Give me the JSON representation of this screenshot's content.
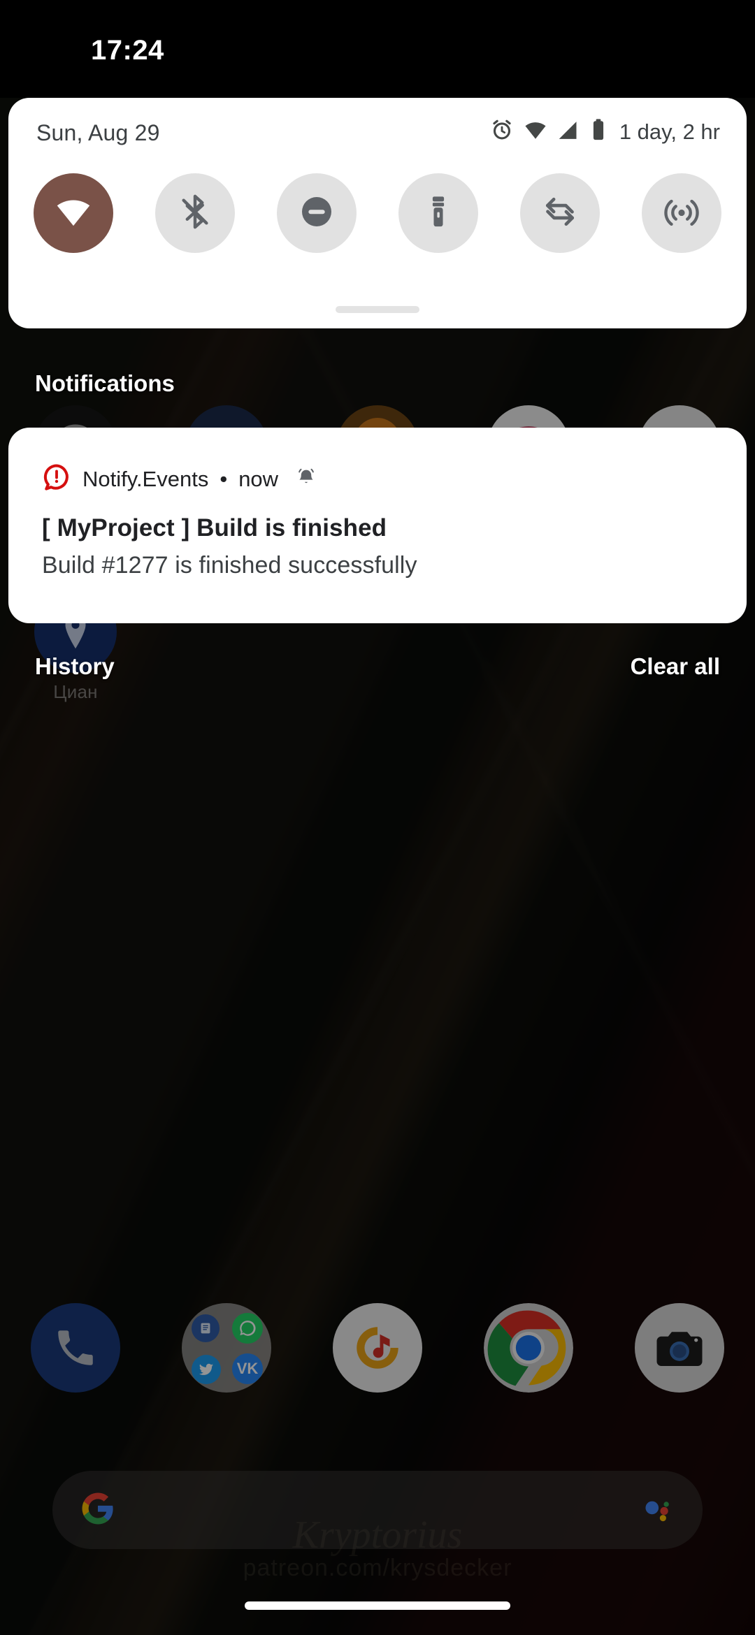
{
  "statusbar": {
    "clock": "17:24"
  },
  "quick_settings": {
    "date": "Sun, Aug 29",
    "battery_estimate": "1 day, 2 hr",
    "status_icons": [
      "alarm-icon",
      "wifi-icon",
      "cellular-signal-icon",
      "battery-icon"
    ],
    "active_tile_color": "#7a5248",
    "inactive_tile_color": "#e1e1e1",
    "tiles": [
      {
        "name": "wifi",
        "label": "Wi-Fi",
        "icon": "wifi-icon",
        "active": true
      },
      {
        "name": "bluetooth",
        "label": "Bluetooth",
        "icon": "bluetooth-off-icon",
        "active": false
      },
      {
        "name": "dnd",
        "label": "Do Not Disturb",
        "icon": "do-not-disturb-icon",
        "active": false
      },
      {
        "name": "flashlight",
        "label": "Flashlight",
        "icon": "flashlight-icon",
        "active": false
      },
      {
        "name": "auto-rotate",
        "label": "Auto-rotate",
        "icon": "auto-rotate-icon",
        "active": false
      },
      {
        "name": "hotspot",
        "label": "Hotspot",
        "icon": "hotspot-icon",
        "active": false
      }
    ]
  },
  "notifications": {
    "section_label": "Notifications",
    "items": [
      {
        "app_name": "Notify.Events",
        "separator": "•",
        "time": "now",
        "app_icon": "alert-bubble-icon",
        "alert_icon": "bell-ringing-icon",
        "app_icon_color": "#d50f0f",
        "title": "[ MyProject ] Build is finished",
        "body": "Build #1277 is finished successfully"
      }
    ],
    "history_label": "History",
    "clear_all_label": "Clear all"
  },
  "homescreen": {
    "app_grid": [
      {
        "name": "compass",
        "label": ""
      },
      {
        "name": "mail",
        "label": ""
      },
      {
        "name": "orange-app",
        "label": ""
      },
      {
        "name": "red-mask-app",
        "label": ""
      },
      {
        "name": "blue-red-app",
        "label": ""
      }
    ],
    "app_grid_row2": [
      {
        "name": "cian",
        "label": "Циан"
      }
    ],
    "dock": [
      {
        "name": "phone",
        "icon": "phone-icon"
      },
      {
        "name": "social-folder",
        "icon": "folder-icon"
      },
      {
        "name": "music",
        "icon": "music-note-icon"
      },
      {
        "name": "chrome",
        "icon": "chrome-icon"
      },
      {
        "name": "camera",
        "icon": "camera-icon"
      }
    ],
    "search": {
      "google_logo": "google-g-icon",
      "assistant_icon": "assistant-icon",
      "placeholder": ""
    },
    "wallpaper_watermark": "patreon.com/krysdecker",
    "wallpaper_watermark_script": "Kryptorius"
  }
}
